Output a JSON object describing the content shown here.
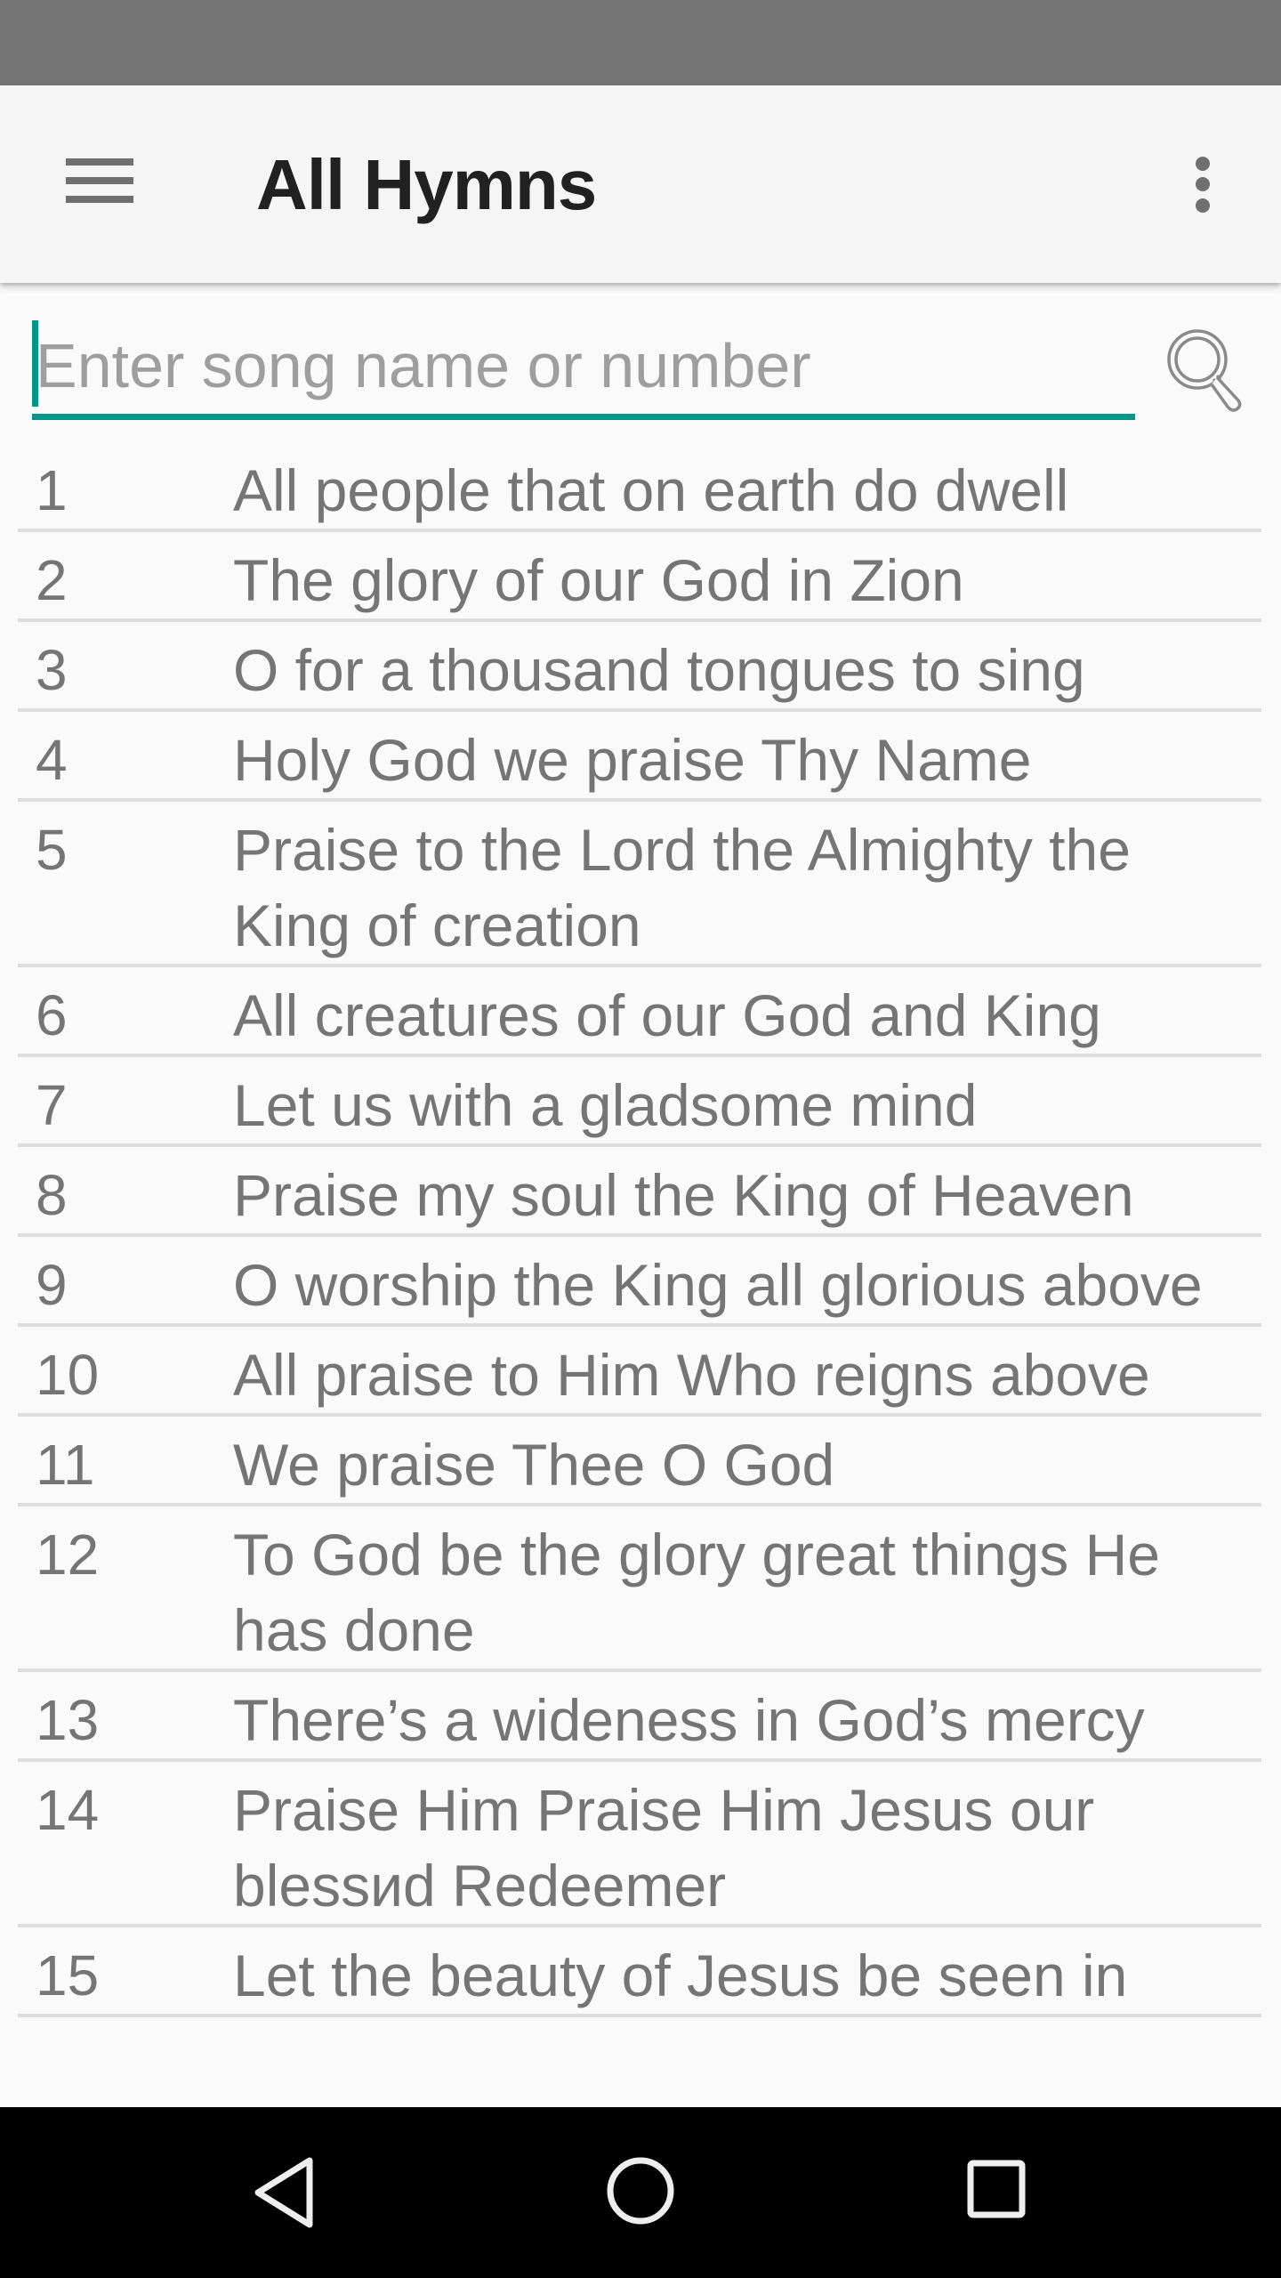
{
  "toolbar": {
    "title": "All Hymns",
    "menu_icon": "hamburger-menu-icon",
    "overflow_icon": "more-vertical-icon"
  },
  "search": {
    "placeholder": "Enter song name or number",
    "value": "",
    "icon": "search-icon",
    "accent_color": "#009688"
  },
  "hymns": [
    {
      "number": "1",
      "title": "All people that on earth do dwell"
    },
    {
      "number": "2",
      "title": "The glory of our God in Zion"
    },
    {
      "number": "3",
      "title": "O for a thousand tongues to sing"
    },
    {
      "number": "4",
      "title": "Holy God we praise Thy Name"
    },
    {
      "number": "5",
      "title": "Praise to the Lord the Almighty the King of creation"
    },
    {
      "number": "6",
      "title": "All creatures of our God and King"
    },
    {
      "number": "7",
      "title": "Let us with a gladsome mind"
    },
    {
      "number": "8",
      "title": "Praise my soul the King of Heaven"
    },
    {
      "number": "9",
      "title": "O worship the King all glorious above"
    },
    {
      "number": "10",
      "title": "All praise to Him Who reigns above"
    },
    {
      "number": "11",
      "title": "We praise Thee O God"
    },
    {
      "number": "12",
      "title": "To God be the glory great things He has done"
    },
    {
      "number": "13",
      "title": "There’s a wideness in God’s mercy"
    },
    {
      "number": "14",
      "title": "Praise Him Praise Him Jesus our blessиd Redeemer"
    },
    {
      "number": "15",
      "title": "Let the beauty of Jesus be seen in"
    }
  ],
  "navbar": {
    "back_icon": "back-triangle-icon",
    "home_icon": "home-circle-icon",
    "recents_icon": "recents-square-icon"
  }
}
